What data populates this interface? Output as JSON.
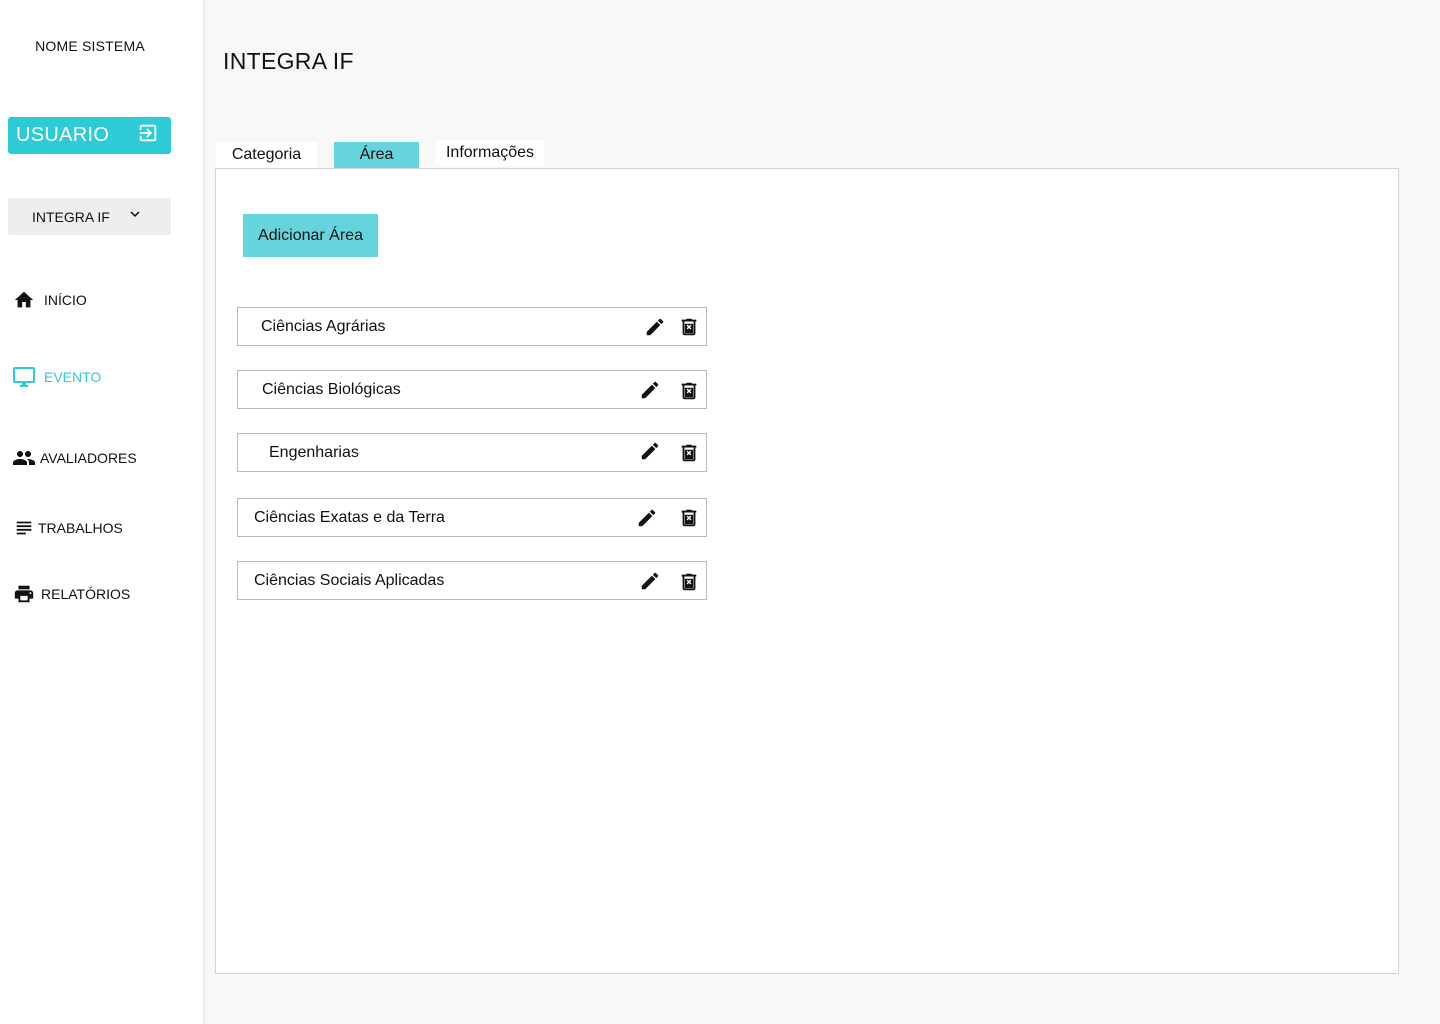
{
  "sidebar": {
    "system_name": "NOME SISTEMA",
    "user_label": "USUARIO",
    "event_select": "INTEGRA IF",
    "nav": [
      {
        "label": "INÍCIO",
        "icon": "home-icon"
      },
      {
        "label": "EVENTO",
        "icon": "monitor-icon"
      },
      {
        "label": "AVALIADORES",
        "icon": "people-icon"
      },
      {
        "label": "TRABALHOS",
        "icon": "list-icon"
      },
      {
        "label": "RELATÓRIOS",
        "icon": "print-icon"
      }
    ],
    "active_nav": "EVENTO"
  },
  "main": {
    "title": "INTEGRA IF",
    "tabs": [
      {
        "label": "Categoria"
      },
      {
        "label": "Área"
      },
      {
        "label": "Informações"
      }
    ],
    "active_tab": "Área",
    "add_button": "Adicionar Área",
    "areas": [
      {
        "name": "Ciências Agrárias"
      },
      {
        "name": "Ciências Biológicas"
      },
      {
        "name": "Engenharias"
      },
      {
        "name": "Ciências Exatas e da Terra"
      },
      {
        "name": "Ciências Sociais Aplicadas"
      }
    ]
  },
  "colors": {
    "accent": "#2ecbd6",
    "accent_light": "#66d4dc",
    "background": "#f8f8f8"
  }
}
